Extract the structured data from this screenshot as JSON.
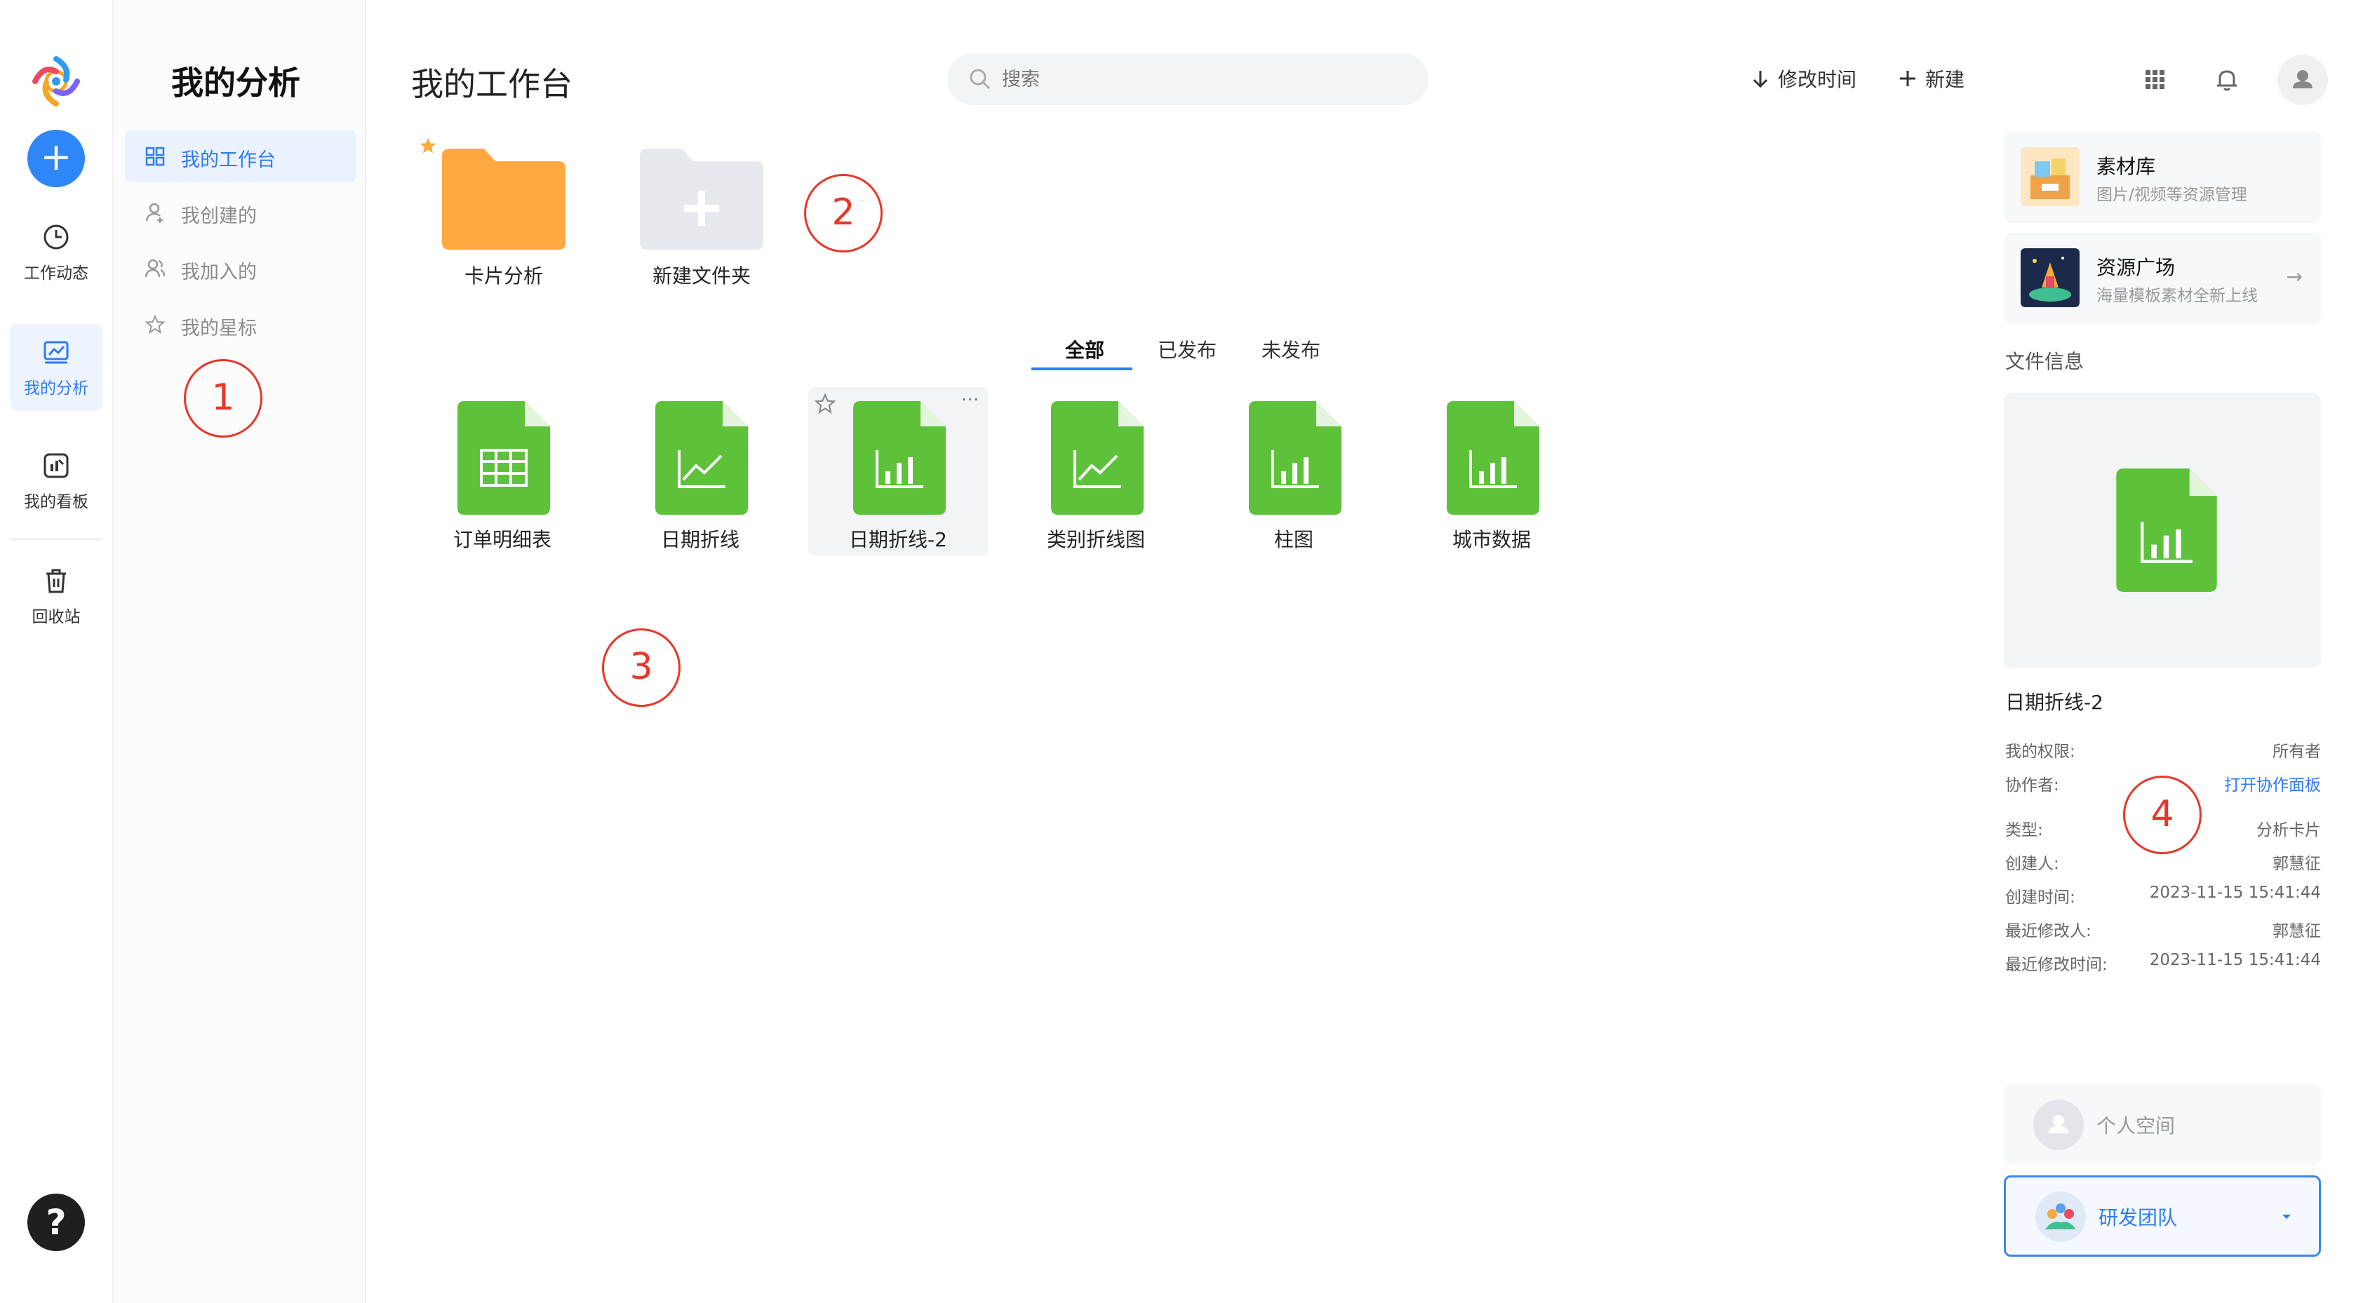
{
  "rail": {
    "items": [
      {
        "label": "工作动态",
        "icon": "clock-icon"
      },
      {
        "label": "我的分析",
        "icon": "analysis-chart-icon",
        "active": true
      },
      {
        "label": "我的看板",
        "icon": "dashboard-icon"
      },
      {
        "label": "回收站",
        "icon": "trash-icon"
      }
    ],
    "help_label": "?"
  },
  "subnav": {
    "title": "我的分析",
    "items": [
      {
        "label": "我的工作台",
        "icon": "grid-icon",
        "active": true
      },
      {
        "label": "我创建的",
        "icon": "user-icon"
      },
      {
        "label": "我加入的",
        "icon": "users-icon"
      },
      {
        "label": "我的星标",
        "icon": "star-icon"
      }
    ]
  },
  "header": {
    "title": "我的工作台",
    "search_placeholder": "搜索",
    "sort_label": "修改时间",
    "new_label": "新建"
  },
  "folders": [
    {
      "label": "卡片分析",
      "starred": true
    },
    {
      "label": "新建文件夹"
    }
  ],
  "tabs": [
    {
      "label": "全部",
      "active": true
    },
    {
      "label": "已发布"
    },
    {
      "label": "未发布"
    }
  ],
  "files": [
    {
      "label": "订单明细表",
      "kind": "table"
    },
    {
      "label": "日期折线",
      "kind": "line"
    },
    {
      "label": "日期折线-2",
      "kind": "bar",
      "hovered": true
    },
    {
      "label": "类别折线图",
      "kind": "line"
    },
    {
      "label": "柱图",
      "kind": "bar"
    },
    {
      "label": "城市数据",
      "kind": "bar"
    }
  ],
  "markers": [
    "1",
    "2",
    "3",
    "4"
  ],
  "right": {
    "resources": [
      {
        "title": "素材库",
        "subtitle": "图片/视频等资源管理"
      },
      {
        "title": "资源广场",
        "subtitle": "海量模板素材全新上线"
      }
    ],
    "file_info_label": "文件信息",
    "file_name": "日期折线-2",
    "info": [
      {
        "key": "我的权限:",
        "value": "所有者"
      },
      {
        "key": "协作者:",
        "value": "打开协作面板",
        "link": true
      },
      {
        "key": "类型:",
        "value": "分析卡片"
      },
      {
        "key": "创建人:",
        "value": "郭慧征"
      },
      {
        "key": "创建时间:",
        "value": "2023-11-15 15:41:44"
      },
      {
        "key": "最近修改人:",
        "value": "郭慧征"
      },
      {
        "key": "最近修改时间:",
        "value": "2023-11-15 15:41:44"
      }
    ],
    "personal_space": "个人空间",
    "team_space": "研发团队"
  },
  "colors": {
    "accent": "#2f7bf0",
    "folder": "#ffa940",
    "file_green": "#5ec13a",
    "marker_red": "#e8362a"
  }
}
